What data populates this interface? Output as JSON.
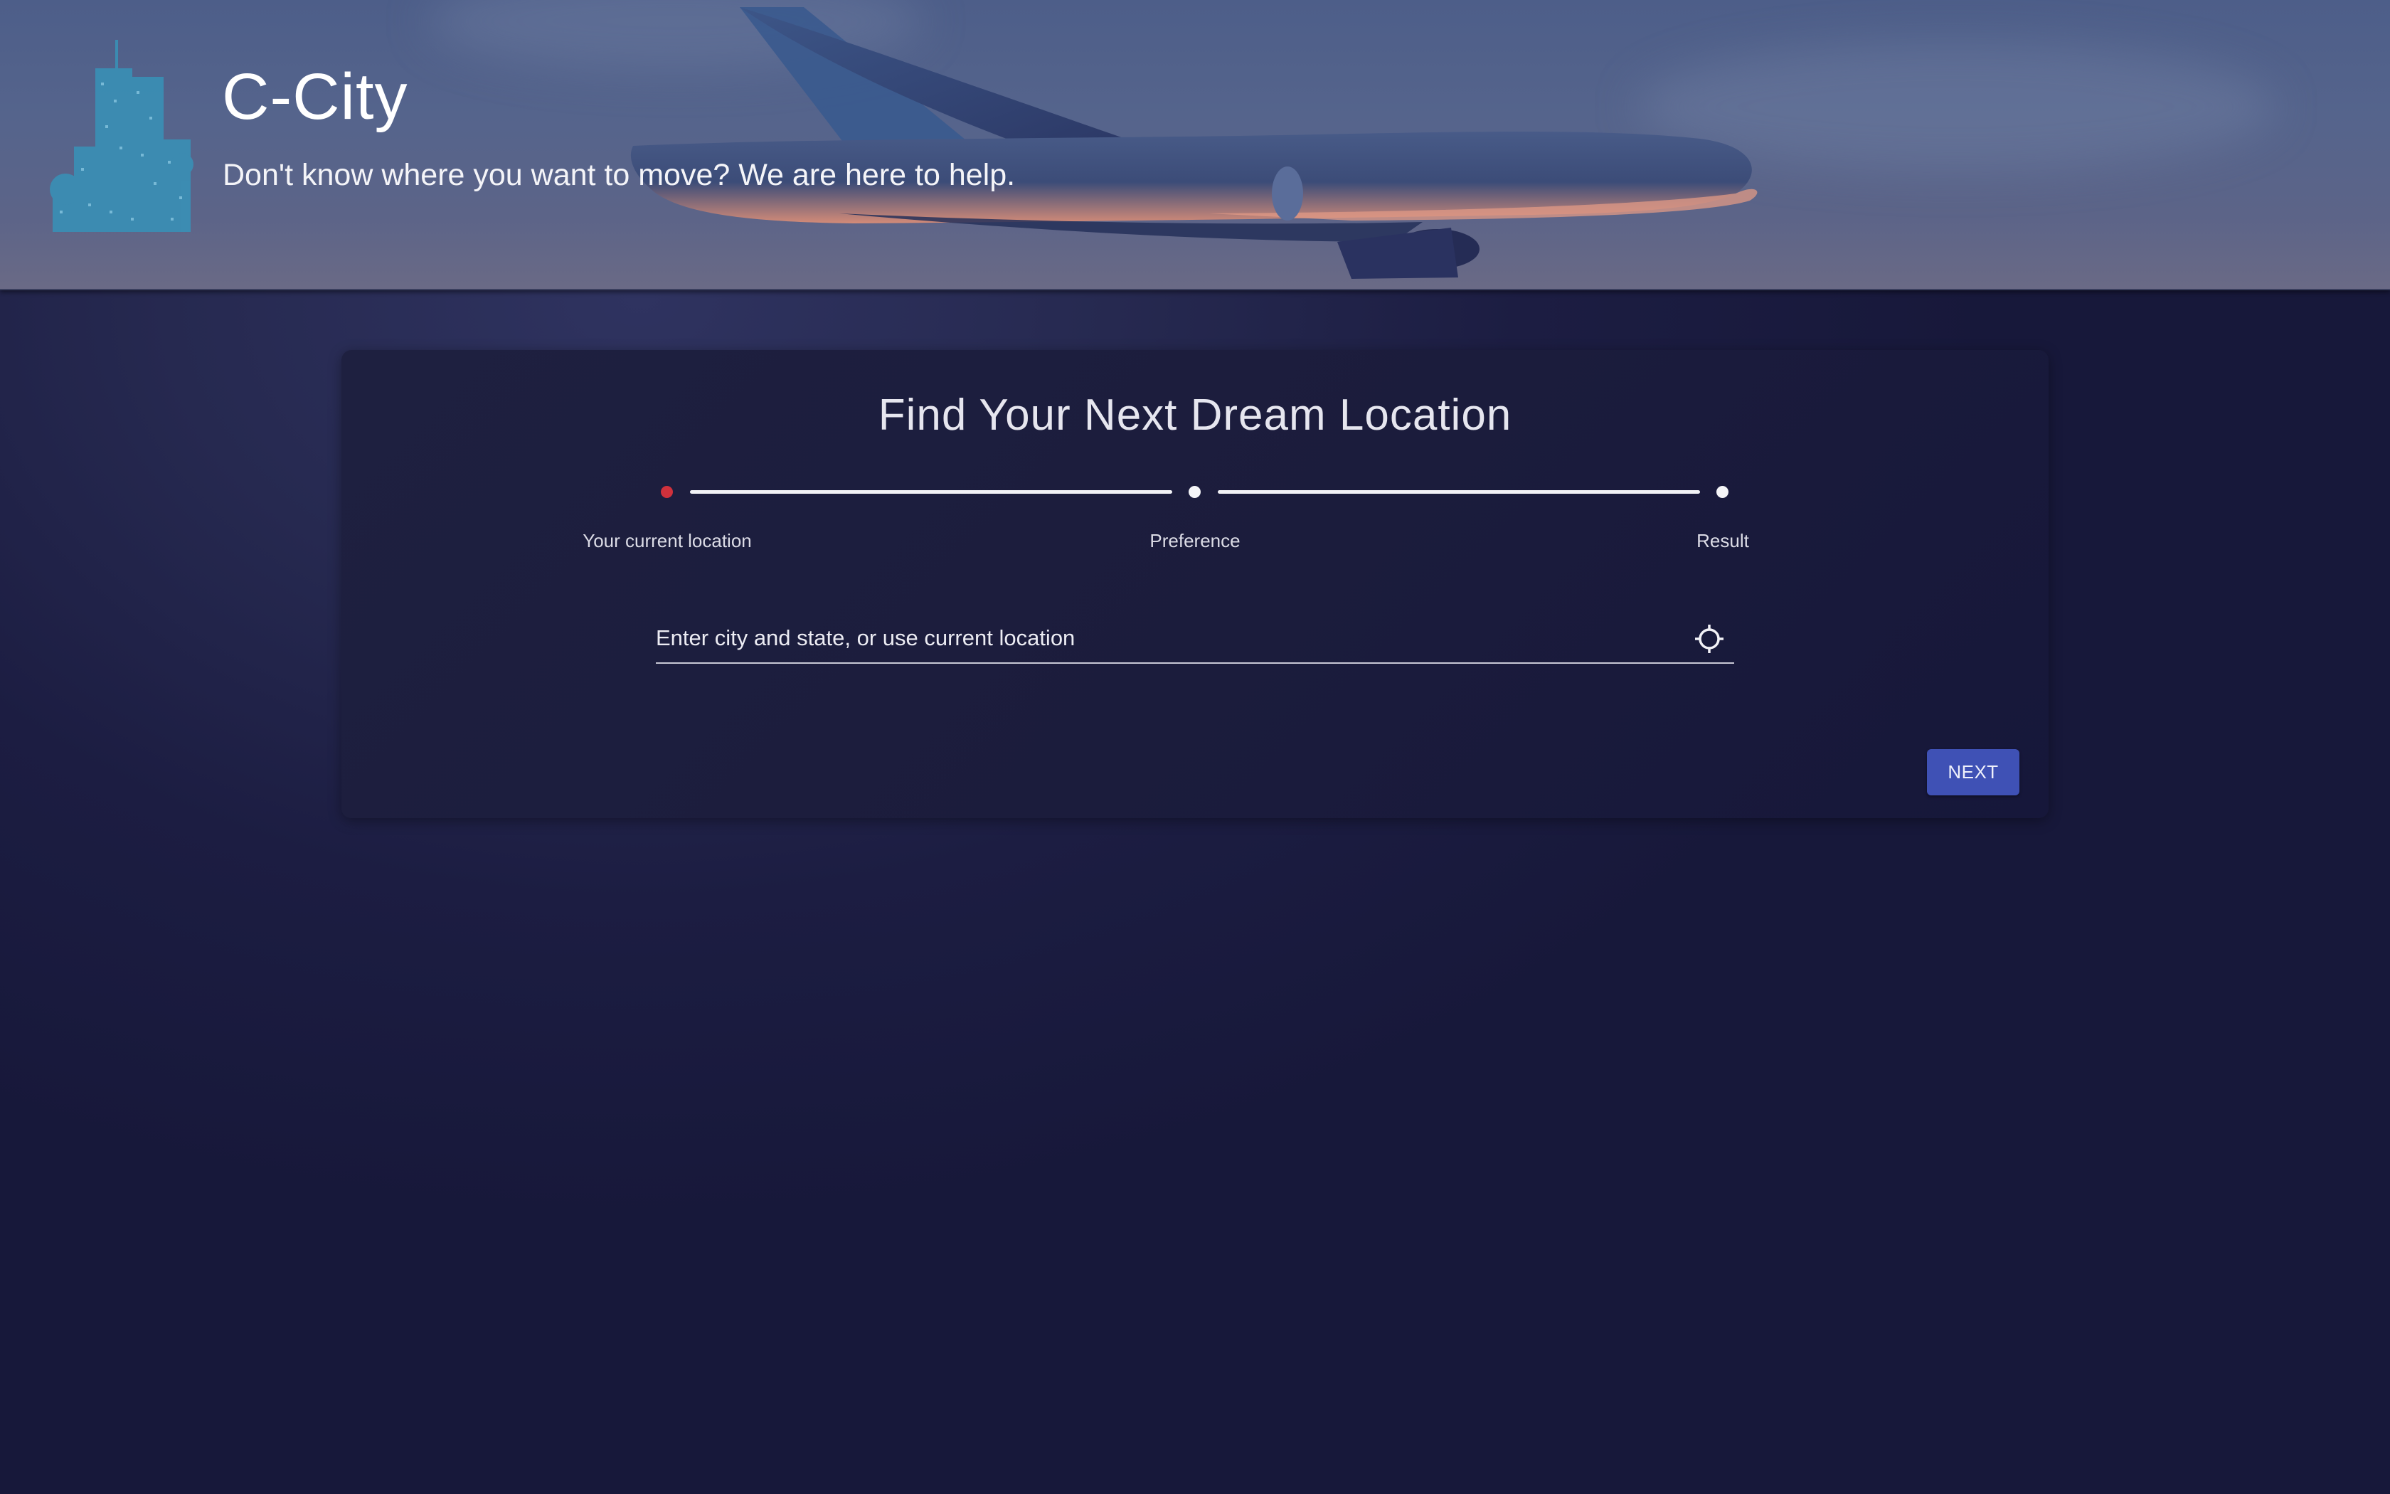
{
  "header": {
    "title": "C-City",
    "tagline": "Don't know where you want to move? We are here to help."
  },
  "finder": {
    "title": "Find Your Next Dream Location",
    "steps": [
      {
        "label": "Your current location",
        "active": true
      },
      {
        "label": "Preference",
        "active": false
      },
      {
        "label": "Result",
        "active": false
      }
    ],
    "location_input": {
      "placeholder": "Enter city and state, or use current location",
      "value": ""
    },
    "next_label": "NEXT"
  },
  "icons": {
    "logo": "city-buildings-logo",
    "locate": "crosshair-icon",
    "background": "airplane-illustration"
  },
  "colors": {
    "active_step": "#d0313c",
    "primary_button": "#3f51b5",
    "page_background": "#1c1d42"
  }
}
